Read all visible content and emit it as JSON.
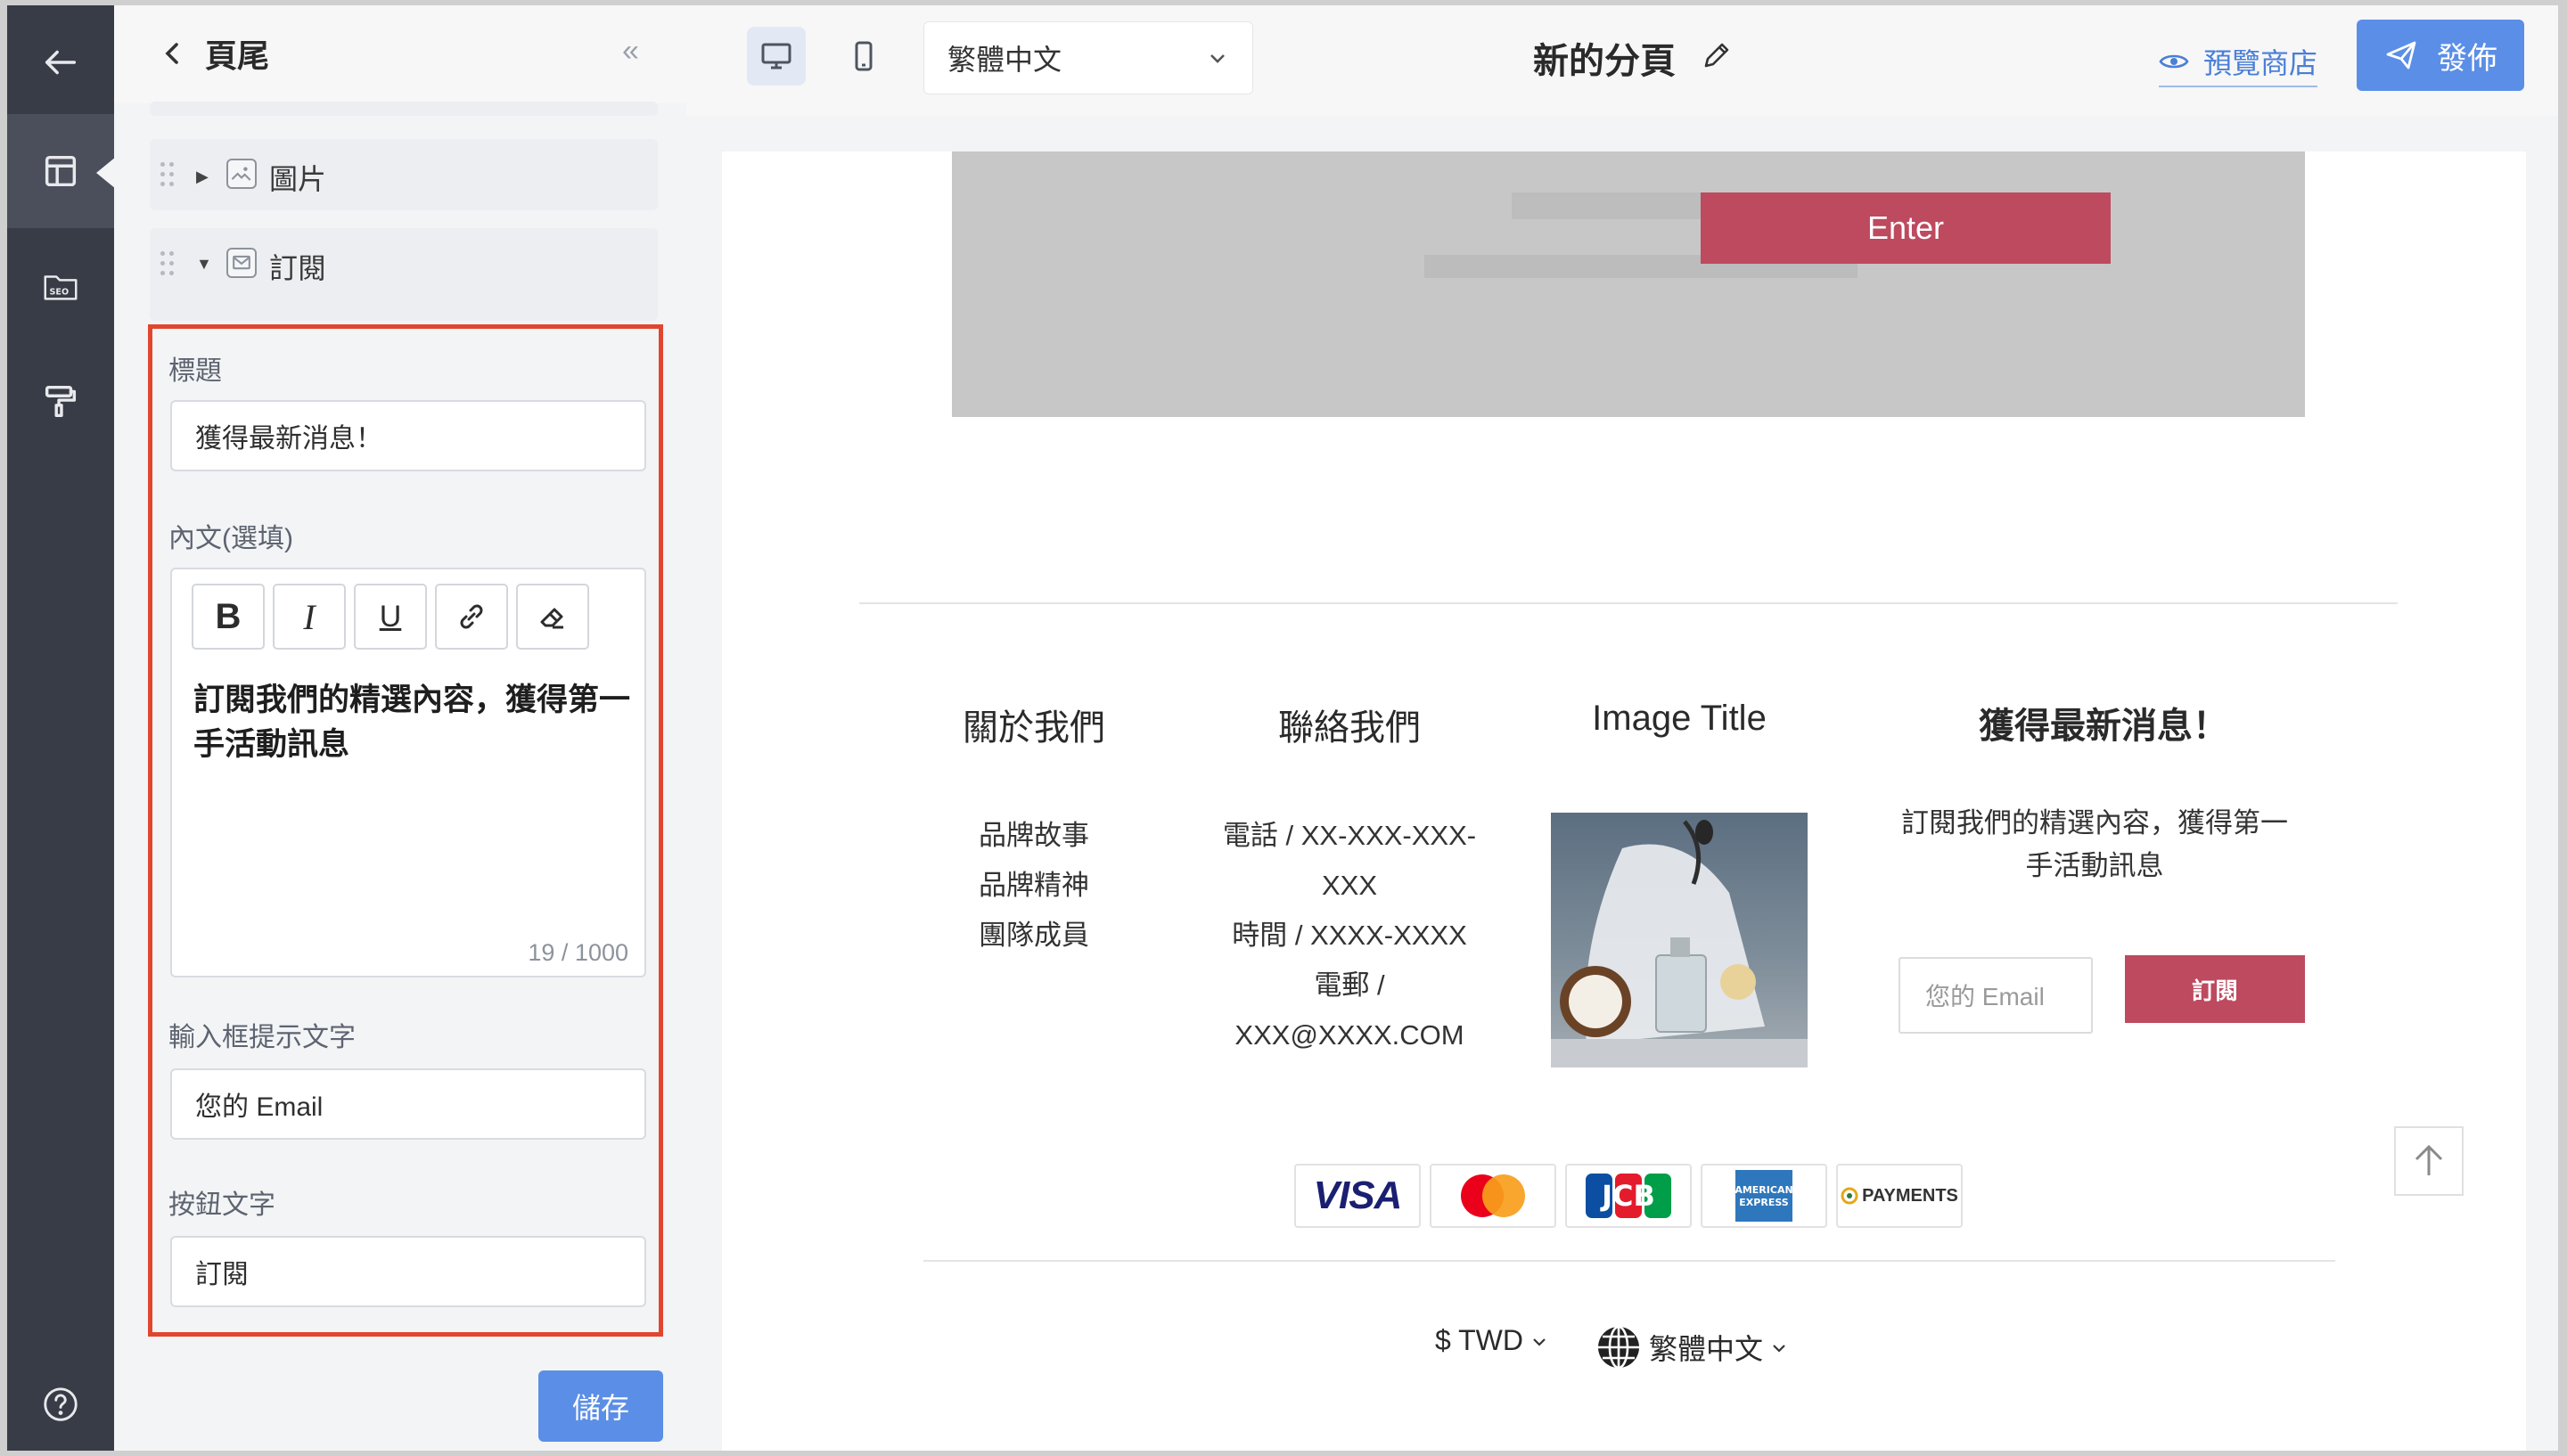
{
  "panel": {
    "title": "頁尾",
    "collapse_glyph": "«",
    "items": [
      {
        "label": "圖片",
        "icon": "image-icon",
        "expanded": false
      },
      {
        "label": "訂閱",
        "icon": "mail-icon",
        "expanded": true
      }
    ],
    "fields": {
      "title_label": "標題",
      "title_value": "獲得最新消息！",
      "body_label": "內文(選填)",
      "body_value": "訂閱我們的精選內容，獲得第一手活動訊息",
      "body_counter": "19 / 1000",
      "placeholder_label": "輸入框提示文字",
      "placeholder_value": "您的 Email",
      "button_label": "按鈕文字",
      "button_value": "訂閱"
    },
    "toolbar": {
      "bold": "B",
      "italic": "I",
      "underline": "U"
    },
    "save_label": "儲存"
  },
  "topbar": {
    "language": "繁體中文",
    "page_name": "新的分頁",
    "preview_label": "預覽商店",
    "publish_label": "發佈"
  },
  "preview": {
    "banner_button": "Enter",
    "columns": [
      {
        "title": "關於我們",
        "lines": [
          "品牌故事",
          "品牌精神",
          "團隊成員"
        ]
      },
      {
        "title": "聯絡我們",
        "lines": [
          "電話 / XX-XXX-XXX-",
          "XXX",
          "時間 / XXXX-XXXX",
          "電郵 /",
          "XXX@XXXX.COM"
        ]
      },
      {
        "title": "Image Title"
      },
      {
        "title": "獲得最新消息！",
        "text_1": "訂閱我們的精選內容，獲得第一",
        "text_2": "手活動訊息"
      }
    ],
    "email_placeholder": "您的 Email",
    "subscribe_label": "訂閱",
    "payments": [
      "VISA",
      "Mastercard",
      "JCB",
      "American Express",
      "PAYMENTS"
    ],
    "currency": "$ TWD",
    "language": "繁體中文",
    "colors": {
      "accent": "#bd4a5f",
      "primary": "#5b8ee6",
      "highlight": "#e1462f"
    }
  }
}
